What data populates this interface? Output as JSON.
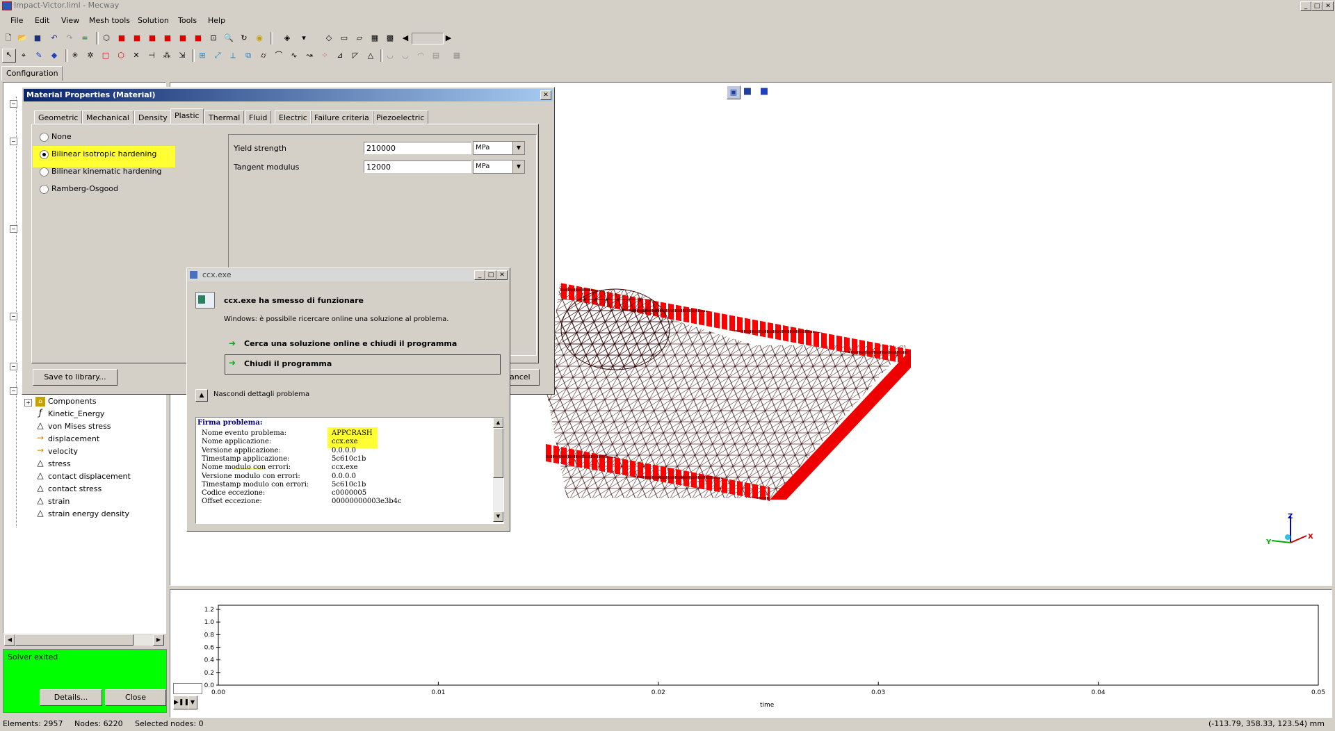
{
  "window": {
    "title": "Impact-Victor.liml - Mecway"
  },
  "menu": [
    "File",
    "Edit",
    "View",
    "Mesh tools",
    "Solution",
    "Tools",
    "Help"
  ],
  "left_tab": "Configuration",
  "tree_items": [
    {
      "label": "Components",
      "icon": "components-icon"
    },
    {
      "label": "Kinetic_Energy",
      "icon": "formula-icon"
    },
    {
      "label": "von Mises stress",
      "icon": "triangle-icon"
    },
    {
      "label": "displacement",
      "icon": "arrow-icon"
    },
    {
      "label": "velocity",
      "icon": "arrow-icon"
    },
    {
      "label": "stress",
      "icon": "triangle-icon"
    },
    {
      "label": "contact displacement",
      "icon": "triangle-icon"
    },
    {
      "label": "contact stress",
      "icon": "triangle-icon"
    },
    {
      "label": "strain",
      "icon": "triangle-icon"
    },
    {
      "label": "strain energy density",
      "icon": "triangle-icon"
    }
  ],
  "solver_panel": {
    "status": "Solver exited",
    "details_label": "Details...",
    "close_label": "Close"
  },
  "material_dialog": {
    "title": "Material Properties (Material)",
    "tabs": [
      "Geometric",
      "Mechanical",
      "Density",
      "Plastic",
      "Thermal",
      "Fluid",
      "Electric",
      "Failure criteria",
      "Piezoelectric"
    ],
    "active_tab": "Plastic",
    "options": [
      "None",
      "Bilinear isotropic hardening",
      "Bilinear kinematic hardening",
      "Ramberg-Osgood"
    ],
    "selected_option": "Bilinear isotropic hardening",
    "fields": [
      {
        "label": "Yield strength",
        "value": "210000",
        "unit": "MPa"
      },
      {
        "label": "Tangent modulus",
        "value": "12000",
        "unit": "MPa"
      }
    ],
    "save_label": "Save to library...",
    "cancel_partial": "ancel"
  },
  "crash_dialog": {
    "title": "ccx.exe",
    "heading": "ccx.exe ha smesso di funzionare",
    "subtext": "Windows: è possibile ricercare online una soluzione al problema.",
    "option1": "Cerca una soluzione online e chiudi il programma",
    "option2": "Chiudi il programma",
    "details_toggle": "Nascondi dettagli problema",
    "details_header": "Firma problema:",
    "details": [
      {
        "k": "Nome evento problema:",
        "v": "APPCRASH"
      },
      {
        "k": "Nome applicazione:",
        "v": "ccx.exe"
      },
      {
        "k": "Versione applicazione:",
        "v": "0.0.0.0"
      },
      {
        "k": "Timestamp applicazione:",
        "v": "5c610c1b"
      },
      {
        "k": "Nome modulo con errori:",
        "v": "ccx.exe"
      },
      {
        "k": "Versione modulo con errori:",
        "v": "0.0.0.0"
      },
      {
        "k": "Timestamp modulo con errori:",
        "v": "5c610c1b"
      },
      {
        "k": "Codice eccezione:",
        "v": "c0000005"
      },
      {
        "k": "Offset eccezione:",
        "v": "00000000003e3b4c"
      }
    ]
  },
  "axes_triad": {
    "x": "X",
    "y": "Y",
    "z": "Z"
  },
  "chart_data": {
    "type": "line",
    "xlabel": "time",
    "ylabel": "",
    "xlim": [
      0,
      0.05
    ],
    "ylim": [
      0,
      1.2
    ],
    "x_ticks": [
      "0.00",
      "0.01",
      "0.02",
      "0.03",
      "0.04",
      "0.05"
    ],
    "y_ticks": [
      "0.0",
      "0.2",
      "0.4",
      "0.6",
      "0.8",
      "1.0",
      "1.2"
    ],
    "series": []
  },
  "status": {
    "elements": "Elements: 2957",
    "nodes": "Nodes: 6220",
    "selected": "Selected nodes: 0",
    "coords": "(-113.79, 358.33, 123.54) mm"
  },
  "colors": {
    "mesh_red": "#ff0000",
    "solver_green": "#00ff00",
    "title_blue": "#0a246a",
    "highlight": "#ffff33"
  }
}
